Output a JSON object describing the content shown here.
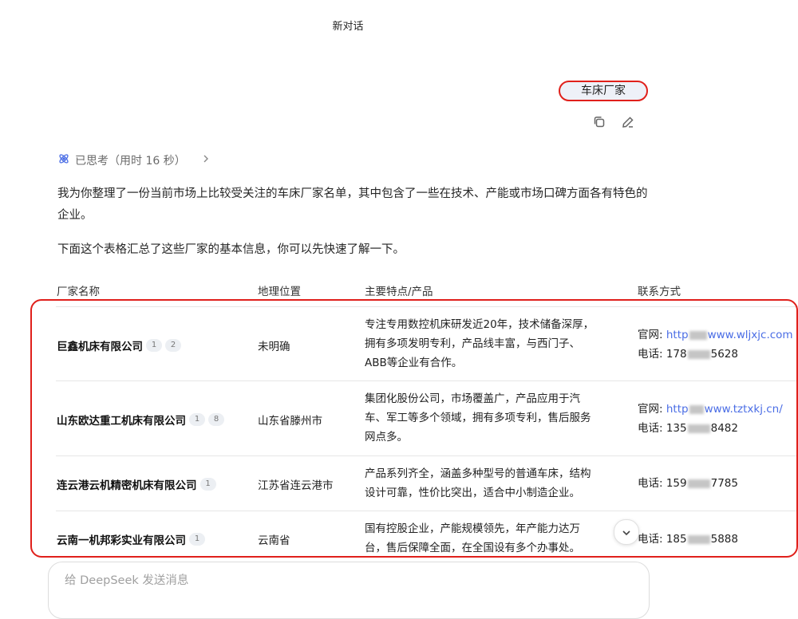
{
  "header": {
    "title": "新对话"
  },
  "user_message": {
    "text": "车床厂家",
    "copy_icon": "copy-icon",
    "edit_icon": "edit-icon"
  },
  "thinking": {
    "label": "已思考（用时 16 秒）"
  },
  "answer": {
    "intro": "我为你整理了一份当前市场上比较受关注的车床厂家名单，其中包含了一些在技术、产能或市场口碑方面各有特色的企业。",
    "table_intro": "下面这个表格汇总了这些厂家的基本信息，你可以先快速了解一下。"
  },
  "table": {
    "headers": [
      "厂家名称",
      "地理位置",
      "主要特点/产品",
      "联系方式"
    ],
    "rows": [
      {
        "name": "巨鑫机床有限公司",
        "refs": [
          "1",
          "2"
        ],
        "location": "未明确",
        "features": [
          "专注专用数控机床研发近20年，技术储备深厚，",
          "拥有多项发明专利，产品线丰富，与西门子、",
          "ABB等企业有合作。"
        ],
        "website_label": "官网: ",
        "website_pre": "http",
        "website_post": "www.wljxjc.com",
        "phone_label": "电话: ",
        "phone_pre": "178",
        "phone_post": "5628"
      },
      {
        "name": "山东欧达重工机床有限公司",
        "refs": [
          "1",
          "8"
        ],
        "location": "山东省滕州市",
        "features": [
          "集团化股份公司，市场覆盖广，产品应用于汽",
          "车、军工等多个领域，拥有多项专利，售后服务",
          "网点多。"
        ],
        "website_label": "官网: ",
        "website_pre": "http",
        "website_post": "www.tztxkj.cn/",
        "phone_label": "电话: ",
        "phone_pre": "135",
        "phone_post": "8482"
      },
      {
        "name": "连云港云机精密机床有限公司",
        "refs": [
          "1"
        ],
        "location": "江苏省连云港市",
        "features": [
          "产品系列齐全，涵盖多种型号的普通车床，结构",
          "设计可靠，性价比突出，适合中小制造企业。"
        ],
        "phone_label": "电话: ",
        "phone_pre": "159",
        "phone_post": "7785"
      },
      {
        "name": "云南一机邦彩实业有限公司",
        "refs": [
          "1"
        ],
        "location": "云南省",
        "features": [
          "国有控股企业，产能规模领先，年产能力达万",
          "台，售后保障全面，在全国设有多个办事处。"
        ],
        "phone_label": "电话: ",
        "phone_pre": "185",
        "phone_post": "5888"
      }
    ]
  },
  "composer": {
    "placeholder": "给 DeepSeek 发送消息"
  },
  "colors": {
    "highlight": "#e0201b",
    "link": "#4a6de5",
    "bubble": "#eef1f8"
  }
}
